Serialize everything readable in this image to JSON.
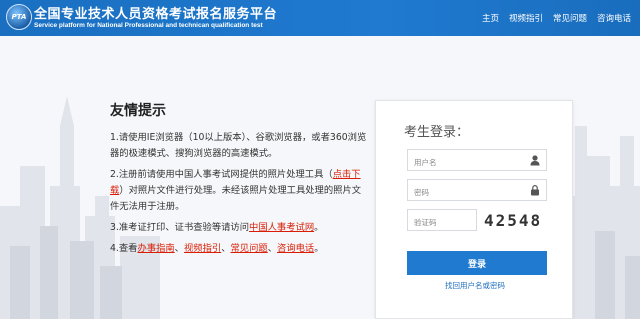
{
  "header": {
    "logo_text": "PTA",
    "title": "全国专业技术人员资格考试报名服务平台",
    "subtitle": "Service platform for National Professional and technican qualification test",
    "nav": [
      "主页",
      "视频指引",
      "常见问题",
      "咨询电话"
    ]
  },
  "tips": {
    "title": "友情提示",
    "t1": "1.请使用IE浏览器（10以上版本）、谷歌浏览器，或者360浏览器的极速模式、搜狗浏览器的高速模式。",
    "t2_a": "2.注册前请使用中国人事考试网提供的照片处理工具（",
    "t2_link": "点击下载",
    "t2_b": "）对照片文件进行处理。未经该照片处理工具处理的照片文件无法用于注册。",
    "t3_a": "3.准考证打印、证书查验等请访问",
    "t3_link": "中国人事考试网",
    "t3_b": "。",
    "t4_a": "4.查看",
    "t4_link1": "办事指南",
    "t4_sep1": "、",
    "t4_link2": "视频指引",
    "t4_sep2": "、",
    "t4_link3": "常见问题",
    "t4_sep3": "、",
    "t4_link4": "咨询电话",
    "t4_b": "。"
  },
  "login": {
    "title": "考生登录：",
    "username_placeholder": "用户名",
    "password_placeholder": "密码",
    "captcha_placeholder": "验证码",
    "captcha_text": "42548",
    "button": "登录",
    "forgot": "找回用户名或密码"
  },
  "colors": {
    "brand": "#1f7ad0",
    "link_red": "#d81e06"
  }
}
